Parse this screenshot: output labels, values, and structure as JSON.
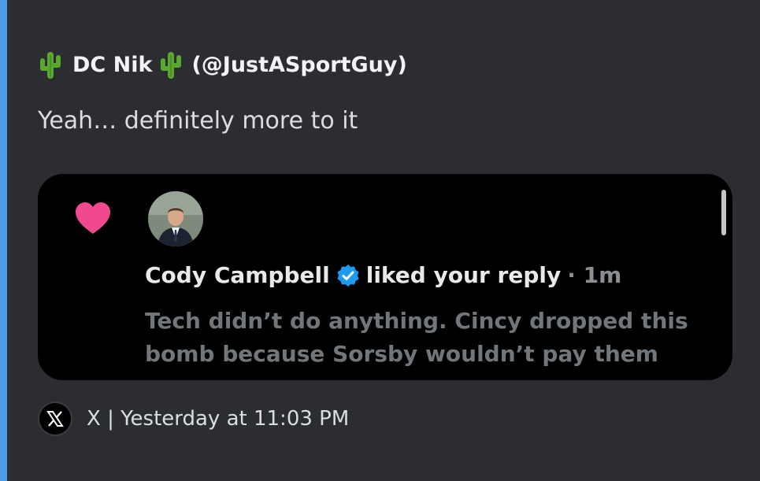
{
  "embed": {
    "author": {
      "name": "DC Nik",
      "handle": "(@JustASportGuy)",
      "emoji_icon": "cactus-icon"
    },
    "description": "Yeah… definitely more to it",
    "notification_card": {
      "icon": "heart-icon",
      "user": "Cody Campbell",
      "verified_icon": "verified-badge-icon",
      "action": "liked your reply",
      "time": "· 1m",
      "reply_text": "Tech didn’t do anything. Cincy dropped this bomb because Sorsby wouldn’t pay them"
    },
    "footer": {
      "icon": "x-logo-icon",
      "text": "X | Yesterday at 11:03 PM"
    }
  },
  "colors": {
    "accent": "#4a9de6",
    "heart": "#f0498f",
    "verified": "#1d9bf0",
    "background": "#2b2d31",
    "card": "#000000"
  }
}
